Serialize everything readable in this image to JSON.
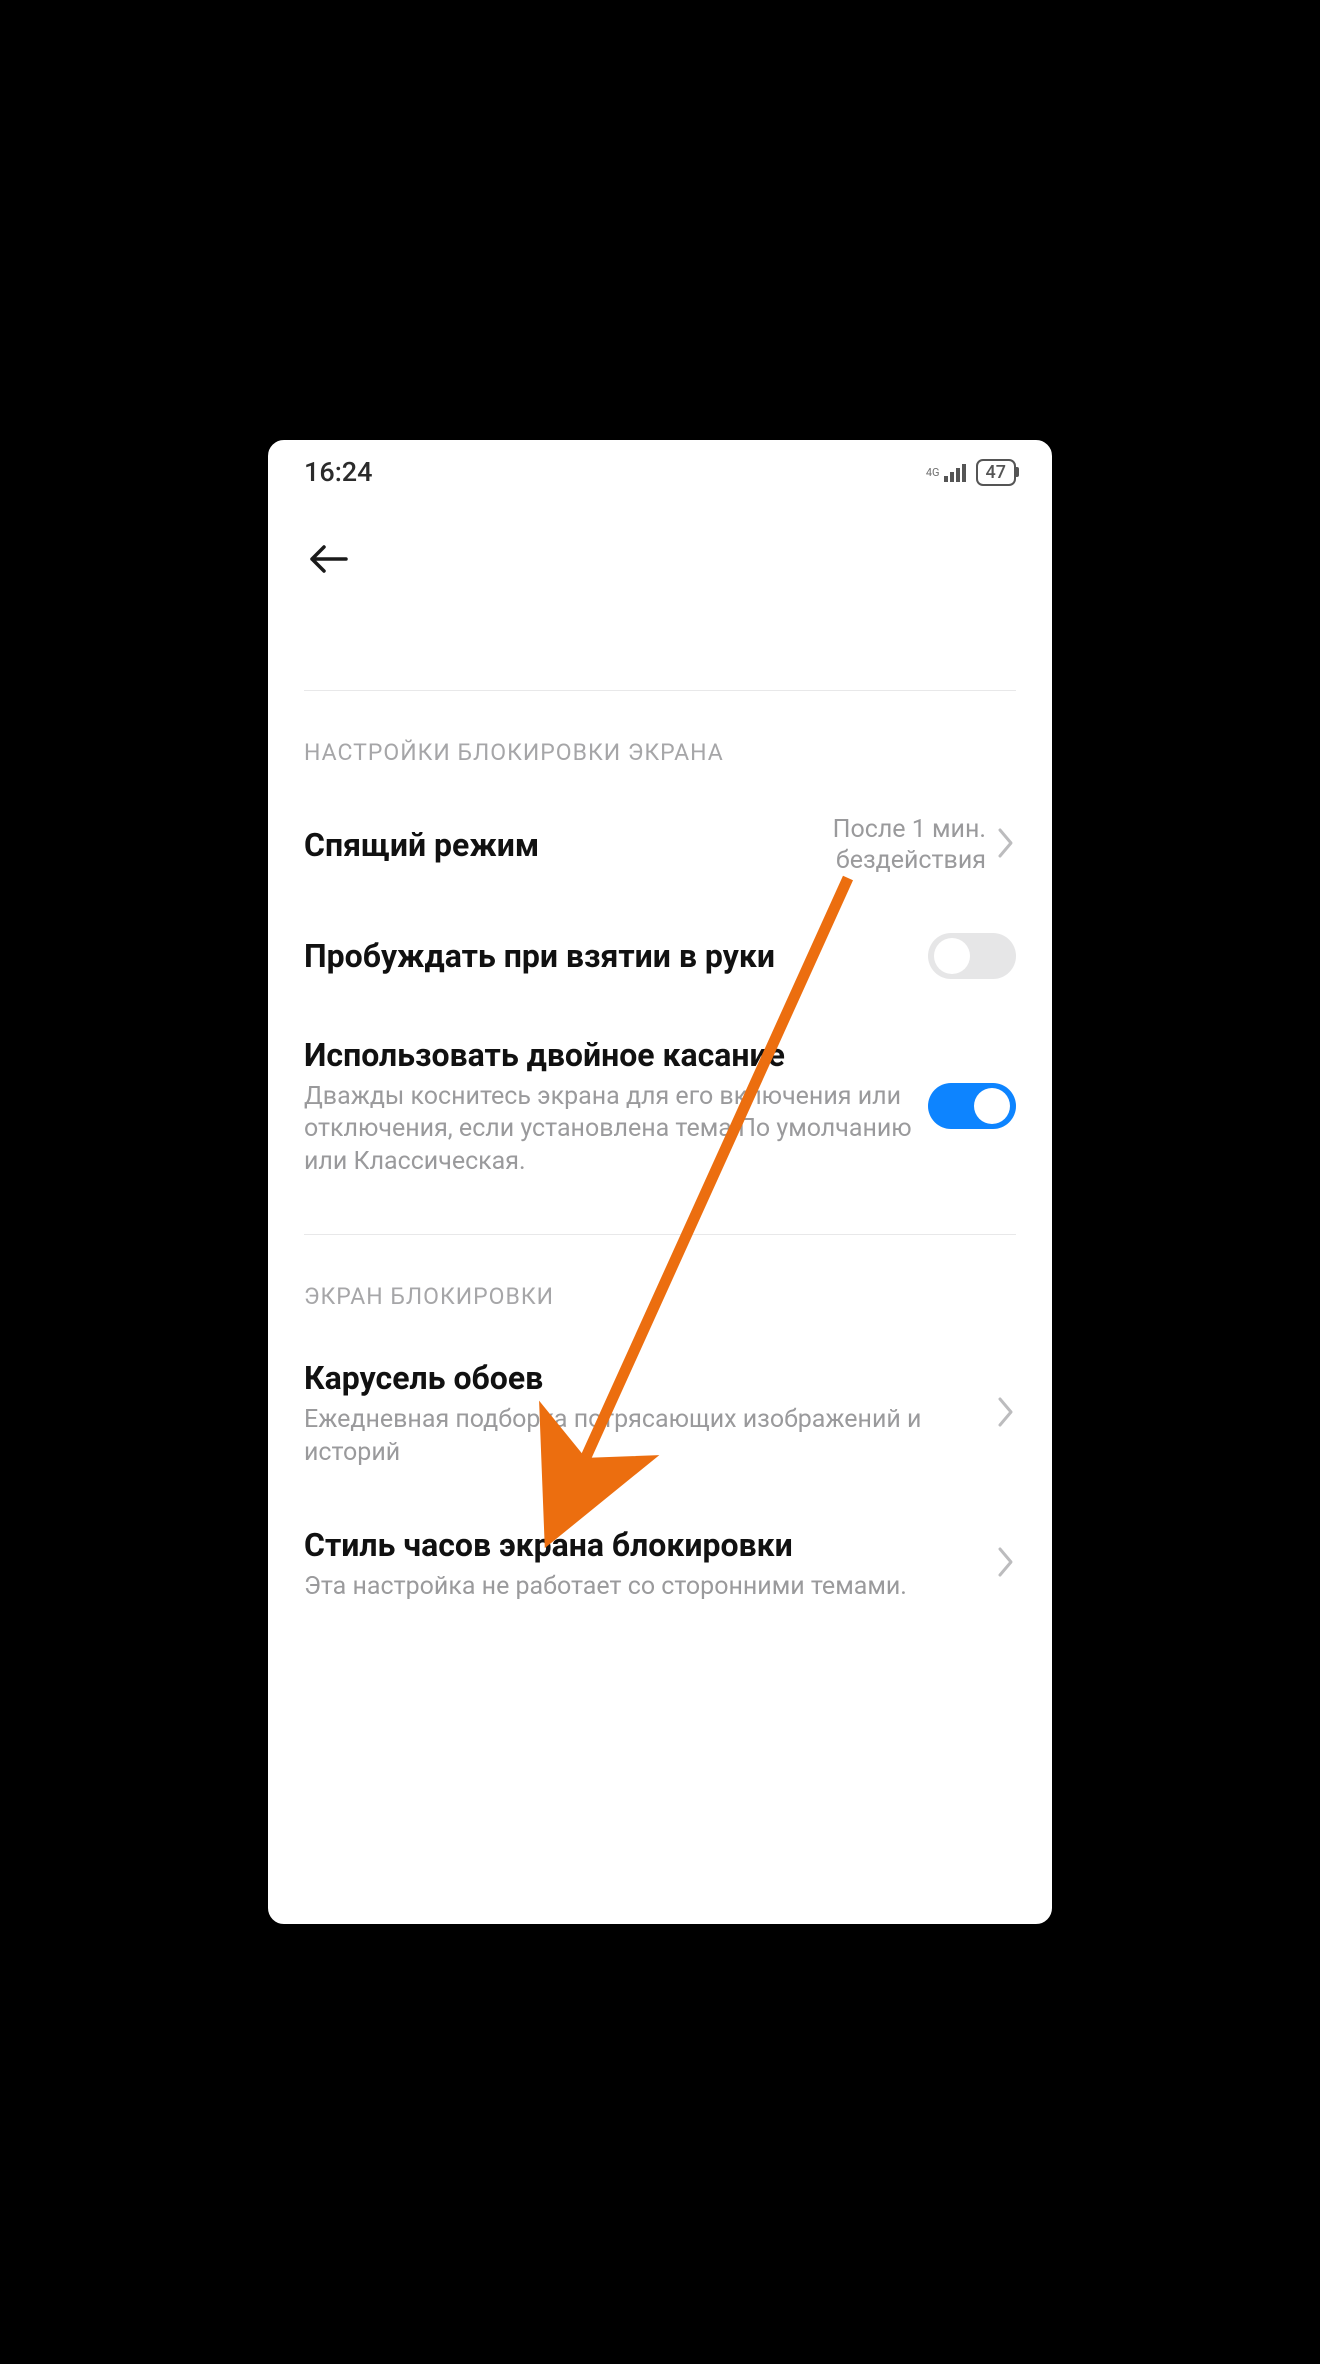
{
  "status": {
    "time": "16:24",
    "network_type": "4G",
    "battery_percent": "47"
  },
  "sections": {
    "lock_settings": {
      "header": "НАСТРОЙКИ БЛОКИРОВКИ ЭКРАНА",
      "sleep": {
        "title": "Спящий режим",
        "value_line1": "После 1 мин.",
        "value_line2": "бездействия"
      },
      "raise_to_wake": {
        "title": "Пробуждать при взятии в руки"
      },
      "double_tap": {
        "title": "Использовать двойное касание",
        "sub": "Дважды коснитесь экрана для его включения или отключения, если установлена тема По умолчанию или Классическая."
      }
    },
    "lock_screen": {
      "header": "ЭКРАН БЛОКИРОВКИ",
      "carousel": {
        "title": "Карусель обоев",
        "sub": "Ежедневная подборка потрясающих изображений и историй"
      },
      "clock_style": {
        "title": "Стиль часов экрана блокировки",
        "sub": "Эта настройка не работает со сторонними темами."
      }
    }
  }
}
